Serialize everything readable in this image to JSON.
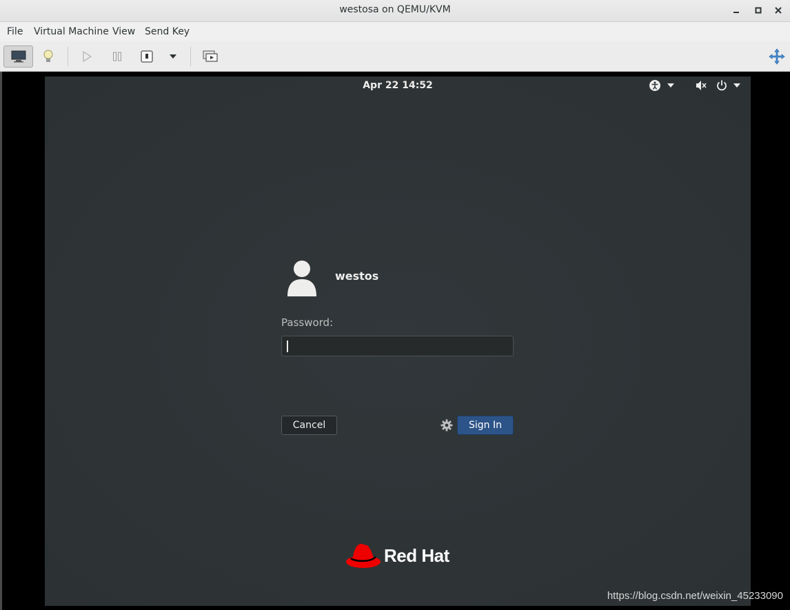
{
  "window": {
    "title": "westosa on QEMU/KVM"
  },
  "menubar": {
    "items": [
      "File",
      "Virtual Machine",
      "View",
      "Send Key"
    ]
  },
  "toolbar": {
    "buttons": [
      "display-console-icon",
      "details-lightbulb-icon",
      "run-icon",
      "pause-icon",
      "shutdown-icon",
      "shutdown-menu-dropdown-icon",
      "snapshots-icon",
      "fullscreen-icon"
    ]
  },
  "guest": {
    "clock": "Apr 22  14:52",
    "user": {
      "name": "westos"
    },
    "password": {
      "label": "Password:",
      "value": ""
    },
    "buttons": {
      "cancel": "Cancel",
      "sign_in": "Sign In"
    },
    "brand": "Red Hat"
  },
  "watermark": "https://blog.csdn.net/weixin_45233090",
  "colors": {
    "guest_bg": "#2f3436",
    "sign_in": "#2d5488",
    "red_hat": "#ee0000"
  }
}
